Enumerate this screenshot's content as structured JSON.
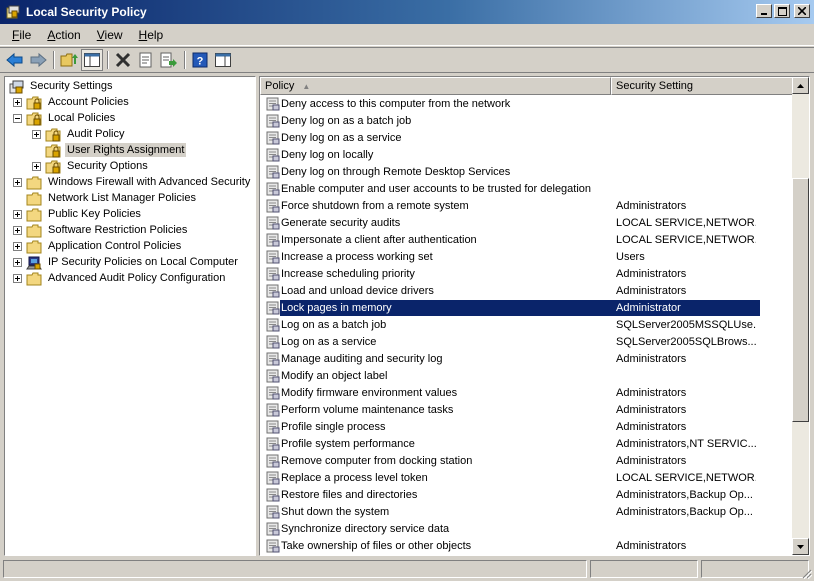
{
  "window": {
    "title": "Local Security Policy",
    "app_icon": "security-policy-icon"
  },
  "menu": [
    {
      "label": "File",
      "key": "F",
      "rest": "ile"
    },
    {
      "label": "Action",
      "key": "A",
      "rest": "ction"
    },
    {
      "label": "View",
      "key": "V",
      "rest": "iew"
    },
    {
      "label": "Help",
      "key": "H",
      "rest": "elp"
    }
  ],
  "toolbar": {
    "icons": [
      "back-arrow-icon",
      "forward-arrow-icon",
      "up-folder-icon",
      "show-hide-tree-icon",
      "delete-icon",
      "properties-icon",
      "export-list-icon",
      "help-icon",
      "show-hide-action-pane-icon"
    ]
  },
  "tree": {
    "root": "Security Settings",
    "items": [
      {
        "label": "Account Policies",
        "level": 1,
        "expander": "plus"
      },
      {
        "label": "Local Policies",
        "level": 1,
        "expander": "minus"
      },
      {
        "label": "Audit Policy",
        "level": 2,
        "expander": "plus"
      },
      {
        "label": "User Rights Assignment",
        "level": 2,
        "expander": "none",
        "selected": true
      },
      {
        "label": "Security Options",
        "level": 2,
        "expander": "plus"
      },
      {
        "label": "Windows Firewall with Advanced Security",
        "level": 1,
        "expander": "plus"
      },
      {
        "label": "Network List Manager Policies",
        "level": 1,
        "expander": "none"
      },
      {
        "label": "Public Key Policies",
        "level": 1,
        "expander": "plus"
      },
      {
        "label": "Software Restriction Policies",
        "level": 1,
        "expander": "plus"
      },
      {
        "label": "Application Control Policies",
        "level": 1,
        "expander": "plus"
      },
      {
        "label": "IP Security Policies on Local Computer",
        "level": 1,
        "expander": "plus"
      },
      {
        "label": "Advanced Audit Policy Configuration",
        "level": 1,
        "expander": "plus"
      }
    ]
  },
  "list": {
    "columns": {
      "policy": "Policy",
      "setting": "Security Setting"
    },
    "rows": [
      {
        "policy": "Deny access to this computer from the network",
        "setting": ""
      },
      {
        "policy": "Deny log on as a batch job",
        "setting": ""
      },
      {
        "policy": "Deny log on as a service",
        "setting": ""
      },
      {
        "policy": "Deny log on locally",
        "setting": ""
      },
      {
        "policy": "Deny log on through Remote Desktop Services",
        "setting": ""
      },
      {
        "policy": "Enable computer and user accounts to be trusted for delegation",
        "setting": ""
      },
      {
        "policy": "Force shutdown from a remote system",
        "setting": "Administrators"
      },
      {
        "policy": "Generate security audits",
        "setting": "LOCAL SERVICE,NETWOR..."
      },
      {
        "policy": "Impersonate a client after authentication",
        "setting": "LOCAL SERVICE,NETWOR..."
      },
      {
        "policy": "Increase a process working set",
        "setting": "Users"
      },
      {
        "policy": "Increase scheduling priority",
        "setting": "Administrators"
      },
      {
        "policy": "Load and unload device drivers",
        "setting": "Administrators"
      },
      {
        "policy": "Lock pages in memory",
        "setting": "Administrator",
        "selected": true
      },
      {
        "policy": "Log on as a batch job",
        "setting": "SQLServer2005MSSQLUse..."
      },
      {
        "policy": "Log on as a service",
        "setting": "SQLServer2005SQLBrows..."
      },
      {
        "policy": "Manage auditing and security log",
        "setting": "Administrators"
      },
      {
        "policy": "Modify an object label",
        "setting": ""
      },
      {
        "policy": "Modify firmware environment values",
        "setting": "Administrators"
      },
      {
        "policy": "Perform volume maintenance tasks",
        "setting": "Administrators"
      },
      {
        "policy": "Profile single process",
        "setting": "Administrators"
      },
      {
        "policy": "Profile system performance",
        "setting": "Administrators,NT SERVIC..."
      },
      {
        "policy": "Remove computer from docking station",
        "setting": "Administrators"
      },
      {
        "policy": "Replace a process level token",
        "setting": "LOCAL SERVICE,NETWOR..."
      },
      {
        "policy": "Restore files and directories",
        "setting": "Administrators,Backup Op..."
      },
      {
        "policy": "Shut down the system",
        "setting": "Administrators,Backup Op..."
      },
      {
        "policy": "Synchronize directory service data",
        "setting": ""
      },
      {
        "policy": "Take ownership of files or other objects",
        "setting": "Administrators"
      }
    ]
  },
  "scrollbar": {
    "position_fraction": 0.42,
    "visible_fraction": 0.55
  },
  "colors": {
    "selection": "#0a246a",
    "title_start": "#0a246a",
    "title_end": "#a6caf0"
  }
}
